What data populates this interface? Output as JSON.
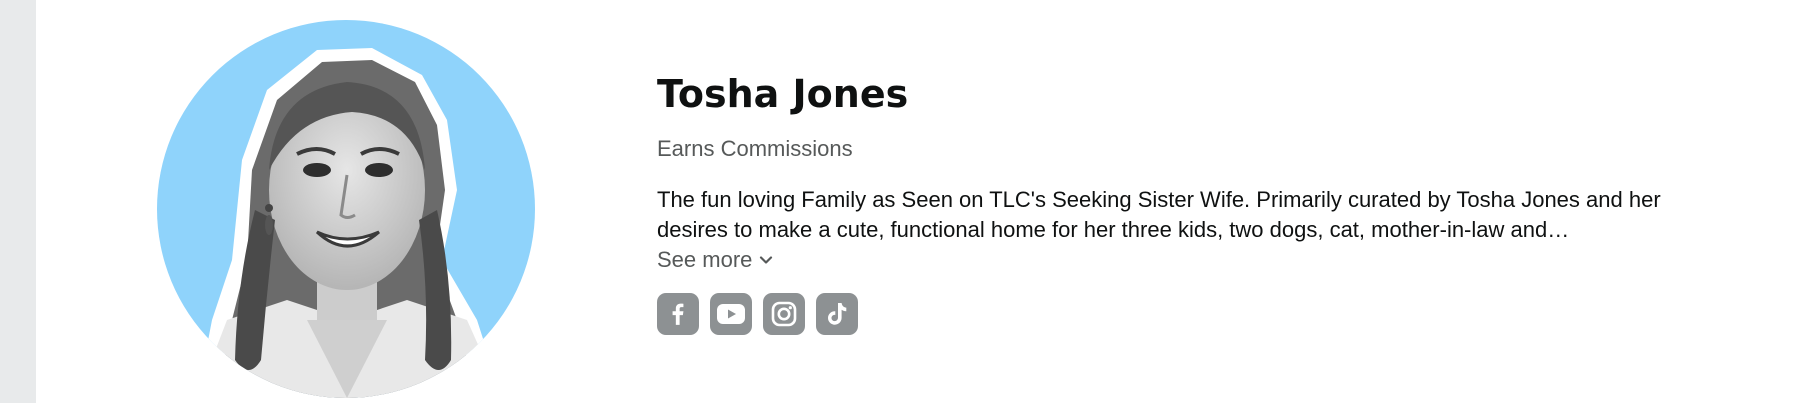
{
  "profile": {
    "name": "Tosha Jones",
    "subtitle": "Earns Commissions",
    "bio": "The fun loving Family as Seen on TLC's Seeking Sister Wife. Primarily curated by Tosha Jones and her desires to make a cute, functional home for her three kids, two dogs, cat, mother-in-law and…",
    "see_more_label": "See more",
    "avatar_alt": "Tosha Jones"
  },
  "social_links": [
    {
      "name": "facebook",
      "icon": "facebook-icon"
    },
    {
      "name": "youtube",
      "icon": "youtube-icon"
    },
    {
      "name": "instagram",
      "icon": "instagram-icon"
    },
    {
      "name": "tiktok",
      "icon": "tiktok-icon"
    }
  ],
  "colors": {
    "name_text": "#0f1111",
    "secondary_text": "#565959",
    "avatar_background": "#8fd3fb",
    "social_icon_bg": "#8d9193",
    "left_rail": "#e8eaeb"
  }
}
